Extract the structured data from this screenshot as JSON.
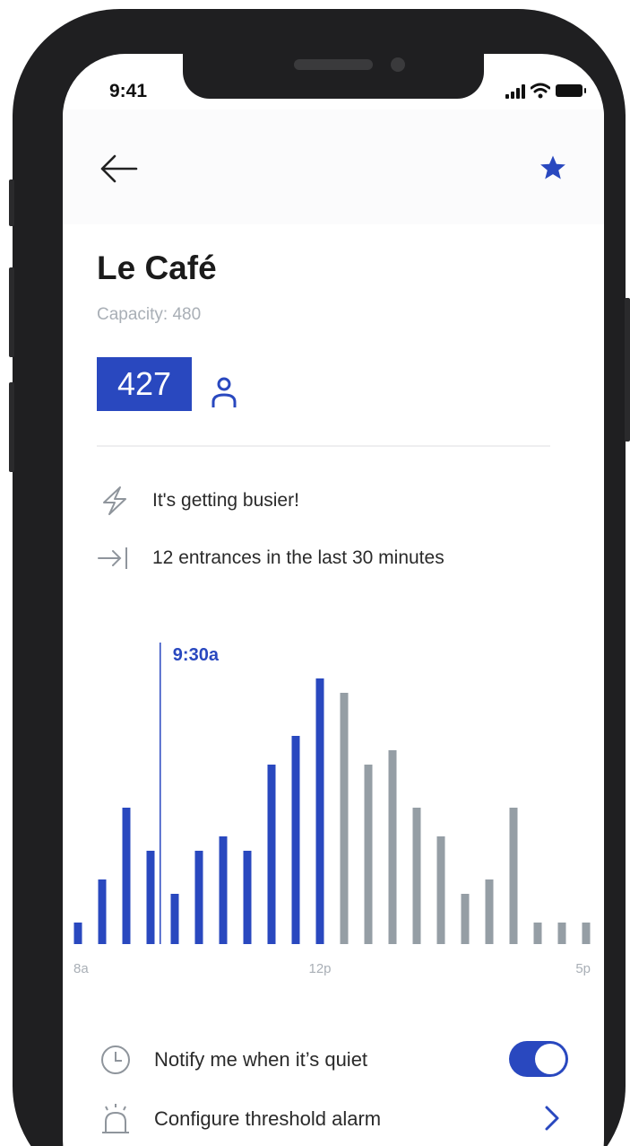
{
  "status_bar": {
    "time": "9:41"
  },
  "venue": {
    "name": "Le Café",
    "capacity_text": "Capacity: 480",
    "current_count": "427"
  },
  "insights": [
    {
      "icon": "lightning-icon",
      "text": "It's getting busier!"
    },
    {
      "icon": "entrance-arrow-icon",
      "text": "12 entrances in the last 30 minutes"
    }
  ],
  "colors": {
    "accent": "#2948bf",
    "past_bar": "#2948bf",
    "future_bar": "#959ea5",
    "muted_text": "#a9afb6"
  },
  "chart_data": {
    "type": "bar",
    "marker_label": "9:30a",
    "marker_index": 3.4,
    "tick_labels": [
      "8a",
      "12p",
      "5p"
    ],
    "values": [
      1.5,
      4.5,
      9.5,
      6.5,
      3.5,
      6.5,
      7.5,
      6.5,
      12.5,
      14.5,
      18.5,
      17.5,
      12.5,
      13.5,
      9.5,
      7.5,
      3.5,
      4.5,
      9.5,
      1.5,
      1.5,
      1.5
    ],
    "past_count": 11,
    "ylim": [
      0,
      19
    ]
  },
  "settings": {
    "notify_label": "Notify me when it’s quiet",
    "notify_enabled": true,
    "alarm_label": "Configure threshold alarm"
  }
}
